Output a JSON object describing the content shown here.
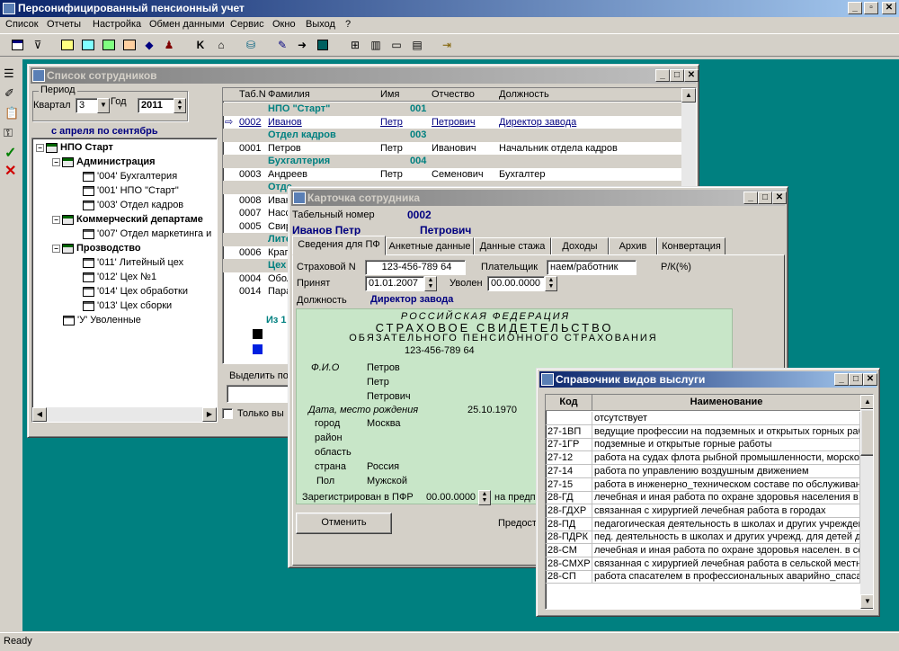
{
  "app": {
    "title": "Персонифицированный пенсионный учет",
    "status": "Ready"
  },
  "menu": [
    "Список",
    "Отчеты",
    "Настройка",
    "Обмен данными",
    "Сервис",
    "Окно",
    "Выход",
    "?"
  ],
  "toolbar_icons": [
    "list-icon",
    "filter-icon",
    "report1-icon",
    "report2-icon",
    "report3-icon",
    "report4-icon",
    "diamond-icon",
    "people-icon",
    "k-icon",
    "bank-icon",
    "network-icon",
    "edit-icon",
    "export-icon",
    "save-icon",
    "tree-icon",
    "columns-icon",
    "window-icon",
    "form-icon",
    "exit-icon"
  ],
  "emp_list": {
    "title": "Список сотрудников",
    "period_label": "Период",
    "quarter_label": "Квартал",
    "quarter_value": "3",
    "year_label": "Год",
    "year_value": "2011",
    "since_label": "с апреля по сентябрь",
    "tree": [
      {
        "label": "НПО Старт",
        "bold": true
      },
      {
        "label": "Администрация",
        "bold": true
      },
      {
        "label": "'004' Бухгалтерия"
      },
      {
        "label": "'001' НПО \"Старт\""
      },
      {
        "label": "'003' Отдел кадров"
      },
      {
        "label": "Коммерческий департаме",
        "bold": true
      },
      {
        "label": "'007' Отдел маркетинга и"
      },
      {
        "label": "Прозводство",
        "bold": true
      },
      {
        "label": "'011' Литейный цех"
      },
      {
        "label": "'012' Цех №1"
      },
      {
        "label": "'014' Цех обработки"
      },
      {
        "label": "'013' Цех сборки"
      },
      {
        "label": "'У' Уволенные"
      }
    ],
    "columns": [
      "Таб.N",
      "Фамилия",
      "Имя",
      "Отчество",
      "Должность"
    ],
    "rows": [
      {
        "group": "НПО \"Старт\"",
        "code": "001"
      },
      {
        "tab": "0002",
        "last": "Иванов",
        "first": "Петр",
        "middle": "Петрович",
        "pos": "Директор завода",
        "link": true,
        "marker": "⇨"
      },
      {
        "group": "Отдел кадров",
        "code": "003"
      },
      {
        "tab": "0001",
        "last": "Петров",
        "first": "Петр",
        "middle": "Иванович",
        "pos": "Начальник отдела кадров"
      },
      {
        "group": "Бухгалтерия",
        "code": "004"
      },
      {
        "tab": "0003",
        "last": "Андреев",
        "first": "Петр",
        "middle": "Семенович",
        "pos": "Бухгалтер"
      },
      {
        "group": "Отде"
      },
      {
        "tab": "0008",
        "last": "Иван"
      },
      {
        "tab": "0007",
        "last": "Насс"
      },
      {
        "tab": "0005",
        "last": "Свир"
      },
      {
        "group": "Лите"
      },
      {
        "tab": "0006",
        "last": "Крап"
      },
      {
        "group": "Цех"
      },
      {
        "tab": "0004",
        "last": "Обол"
      },
      {
        "tab": "0014",
        "last": "Пара"
      }
    ],
    "from_label": "Из 1",
    "select_label": "Выделить по",
    "only_label": "Только вы"
  },
  "card": {
    "title": "Карточка сотрудника",
    "tabnum_label": "Табельный номер",
    "tabnum": "0002",
    "name": "Иванов Петр",
    "patronymic": "Петрович",
    "tabs": [
      "Сведения для ПФ",
      "Анкетные данные",
      "Данные стажа",
      "Доходы",
      "Архив",
      "Конвертация"
    ],
    "snils_label": "Страховой N",
    "snils": "123-456-789 64",
    "payer_label": "Плательщик",
    "payer": "наем/работник",
    "pk_label": "Р/К(%)",
    "hired_label": "Принят",
    "hired": "01.01.2007",
    "fired_label": "Уволен",
    "fired": "00.00.0000",
    "position_label": "Должность",
    "position": "Директор завода",
    "cert": {
      "line1": "РОССИЙСКАЯ ФЕДЕРАЦИЯ",
      "line2": "СТРАХОВОЕ СВИДЕТЕЛЬСТВО",
      "line3": "ОБЯЗАТЕЛЬНОГО ПЕНСИОННОГО СТРАХОВАНИЯ",
      "number": "123-456-789 64",
      "fio_label": "Ф.И.О",
      "last": "Петров",
      "first": "Петр",
      "middle": "Петрович",
      "birth_label": "Дата, место рождения",
      "birth_date": "25.10.1970",
      "city_label": "город",
      "city": "Москва",
      "district_label": "район",
      "region_label": "область",
      "country_label": "страна",
      "country": "Россия",
      "sex_label": "Пол",
      "sex": "Мужской",
      "registered_label": "Зарегистрирован в ПФР",
      "registered": "00.00.0000",
      "on_enterprise_label": "на предпр"
    },
    "cancel": "Отменить",
    "provide_label": "Предост"
  },
  "ref": {
    "title": "Справочник видов выслуги",
    "columns": [
      "Код",
      "Наименование"
    ],
    "rows": [
      [
        "",
        "отсутствует"
      ],
      [
        "27-1ВП",
        "ведущие профессии на подземных и открытых горных рабо"
      ],
      [
        "27-1ГР",
        "подземные и открытые горные работы"
      ],
      [
        "27-12",
        "работа на судах флота рыбной промышленности, морского"
      ],
      [
        "27-14",
        "работа по управлению воздушным движением"
      ],
      [
        "27-15",
        "работа в инженерно_техническом составе по обслуживани"
      ],
      [
        "28-ГД",
        "лечебная и иная работа по охране здоровья населения в го"
      ],
      [
        "28-ГДХР",
        "связанная с хирургией лечебная работа в городах"
      ],
      [
        "28-ПД",
        "педагогическая деятельность в школах и других учреждени"
      ],
      [
        "28-ПДРК",
        "пед. деятельность в школах и других учрежд. для детей для"
      ],
      [
        "28-СМ",
        "лечебная и иная работа по охране здоровья населен. в села"
      ],
      [
        "28-СМХР",
        "связанная с хирургией лечебная работа в сельской местно"
      ],
      [
        "28-СП",
        "работа спасателем в профессиональных аварийно_спасате"
      ]
    ]
  },
  "colors": {
    "teal": "#008080",
    "navy": "#000080",
    "cert_green": "#c8e6c8",
    "face": "#d4d0c8"
  }
}
